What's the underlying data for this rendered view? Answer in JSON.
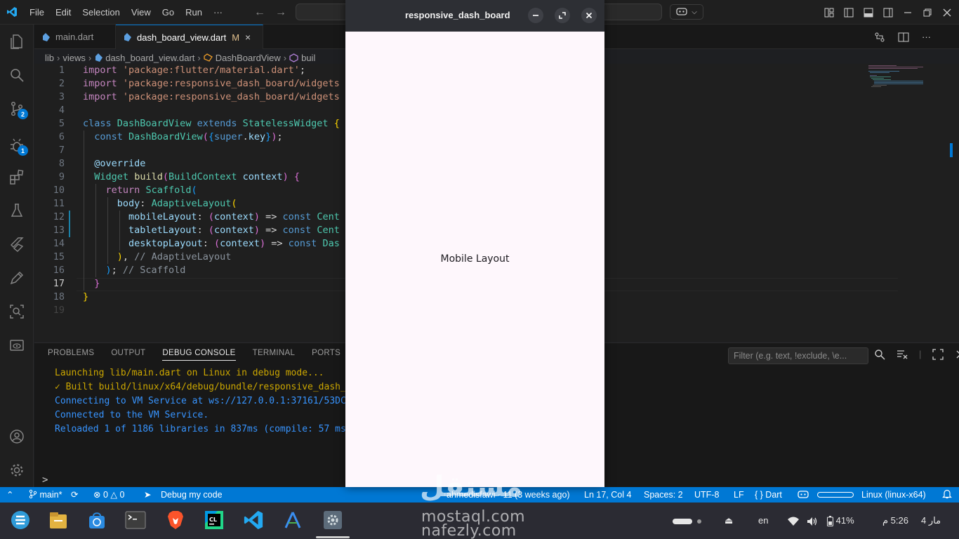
{
  "menu": {
    "items": [
      "File",
      "Edit",
      "Selection",
      "View",
      "Go",
      "Run",
      "···"
    ]
  },
  "tabs": [
    {
      "label": "main.dart",
      "modified": "",
      "close": ""
    },
    {
      "label": "dash_board_view.dart",
      "modified": "M",
      "close": "×"
    }
  ],
  "breadcrumb": [
    "lib",
    "views",
    "dash_board_view.dart",
    "DashBoardView",
    "buil"
  ],
  "editor": {
    "line_numbers": [
      "1",
      "2",
      "3",
      "4",
      "5",
      "6",
      "7",
      "8",
      "9",
      "10",
      "11",
      "12",
      "13",
      "14",
      "15",
      "16",
      "17",
      "18",
      "19"
    ],
    "current_line": "17"
  },
  "panel": {
    "tabs": [
      "PROBLEMS",
      "OUTPUT",
      "DEBUG CONSOLE",
      "TERMINAL",
      "PORTS"
    ],
    "active_tab": "DEBUG CONSOLE",
    "filter_placeholder": "Filter (e.g. text, !exclude, \\e...",
    "console": [
      "Launching lib/main.dart on Linux in debug mode...",
      "✓ Built build/linux/x64/debug/bundle/responsive_dash_",
      "Connecting to VM Service at ws://127.0.0.1:37161/53DC",
      "Connected to the VM Service.",
      "Reloaded 1 of 1186 libraries in 837ms (compile: 57 ms"
    ],
    "prompt": ">"
  },
  "statusbar": {
    "branch": "main*",
    "errors": "0",
    "warnings": "0",
    "debug": "Debug my code",
    "blame": "(3 weeks ago)",
    "blame_prefix": "ahmedisfawi - 11",
    "position": "Ln 17, Col 4",
    "spaces": "Spaces: 2",
    "encoding": "UTF-8",
    "eol": "LF",
    "language": "{ } Dart",
    "device": "Linux (linux-x64)"
  },
  "flutter_window": {
    "title": "responsive_dash_board",
    "body_text": "Mobile Layout"
  },
  "taskbar": {
    "lang": "en",
    "battery": "41%",
    "time": "5:26 م",
    "date": "مار 4"
  },
  "watermark": {
    "brand": "مستقل",
    "line1": "mostaql.com",
    "line2": "nafezly.com"
  },
  "colors": {
    "accent": "#0078d4",
    "editor_bg": "#1f1f1f",
    "flutter_bg": "#fef7fc"
  }
}
